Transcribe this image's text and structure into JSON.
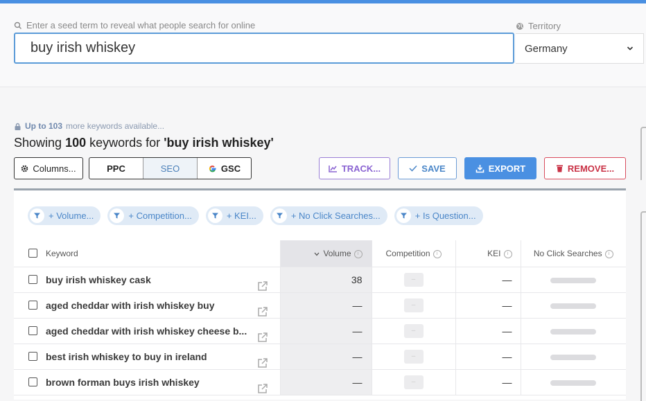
{
  "search": {
    "hint": "Enter a seed term to reveal what people search for online",
    "value": "buy irish whiskey",
    "territory_label": "Territory",
    "territory_value": "Germany"
  },
  "summary": {
    "availability_prefix": "Up to 103",
    "availability_suffix": "more keywords available...",
    "showing_prefix": "Showing",
    "count": "100",
    "showing_mid": "keywords for",
    "query": "'buy irish whiskey'"
  },
  "toolbar": {
    "columns": "Columns...",
    "ppc": "PPC",
    "seo": "SEO",
    "gsc": "GSC",
    "track": "TRACK...",
    "save": "SAVE",
    "export": "EXPORT",
    "remove": "REMOVE..."
  },
  "filters": [
    "+ Volume...",
    "+ Competition...",
    "+ KEI...",
    "+ No Click Searches...",
    "+ Is Question..."
  ],
  "table": {
    "headers": {
      "keyword": "Keyword",
      "volume": "Volume",
      "competition": "Competition",
      "kei": "KEI",
      "ncs": "No Click Searches"
    },
    "rows": [
      {
        "keyword": "buy irish whiskey cask",
        "volume": "38",
        "comp": "–",
        "kei": "—"
      },
      {
        "keyword": "aged cheddar with irish whiskey buy",
        "volume": "—",
        "comp": "–",
        "kei": "—"
      },
      {
        "keyword": "aged cheddar with irish whiskey cheese b...",
        "volume": "—",
        "comp": "–",
        "kei": "—"
      },
      {
        "keyword": "best irish whiskey to buy in ireland",
        "volume": "—",
        "comp": "–",
        "kei": "—"
      },
      {
        "keyword": "brown forman buys irish whiskey",
        "volume": "—",
        "comp": "–",
        "kei": "—"
      }
    ]
  },
  "colors": {
    "accent": "#4a90e2",
    "track": "#8a63d2",
    "remove": "#c93145",
    "chip_bg": "#dfeaf6"
  }
}
